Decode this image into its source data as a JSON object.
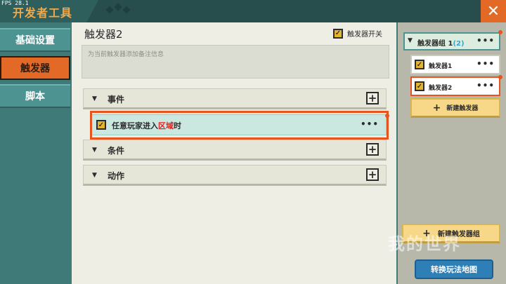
{
  "window": {
    "fps": "FPS 28.1",
    "title": "开发者工具",
    "close_symbol": "✕"
  },
  "sidebar": {
    "items": [
      {
        "label": "基础设置",
        "active": false
      },
      {
        "label": "触发器",
        "active": true
      },
      {
        "label": "脚本",
        "active": false
      }
    ]
  },
  "main": {
    "title": "触发器2",
    "toggle_label": "触发器开关",
    "toggle_checked": true,
    "note_placeholder": "为当前触发器添加备注信息",
    "sections": [
      {
        "label": "事件"
      },
      {
        "label": "条件"
      },
      {
        "label": "动作"
      }
    ],
    "event": {
      "text_before": "任意玩家进入",
      "text_highlight": "区域",
      "text_after": "时",
      "more": "•••"
    },
    "plus_symbol": "+"
  },
  "right_panel": {
    "group": {
      "label": "触发器组 1",
      "count": "(2)",
      "more": "•••"
    },
    "triggers": [
      {
        "label": "触发器1",
        "selected": false,
        "more": "•••"
      },
      {
        "label": "触发器2",
        "selected": true,
        "more": "•••"
      }
    ],
    "new_trigger_label": "新建触发器",
    "new_group_label": "新建触发器组",
    "switch_map_label": "转换玩法地图"
  },
  "watermark": "我的世界",
  "colors": {
    "accent_orange": "#e26a26",
    "teal": "#3f7a78",
    "highlight_red": "#e02020",
    "button_yellow": "#f7d889",
    "button_blue": "#2f7fb7"
  }
}
